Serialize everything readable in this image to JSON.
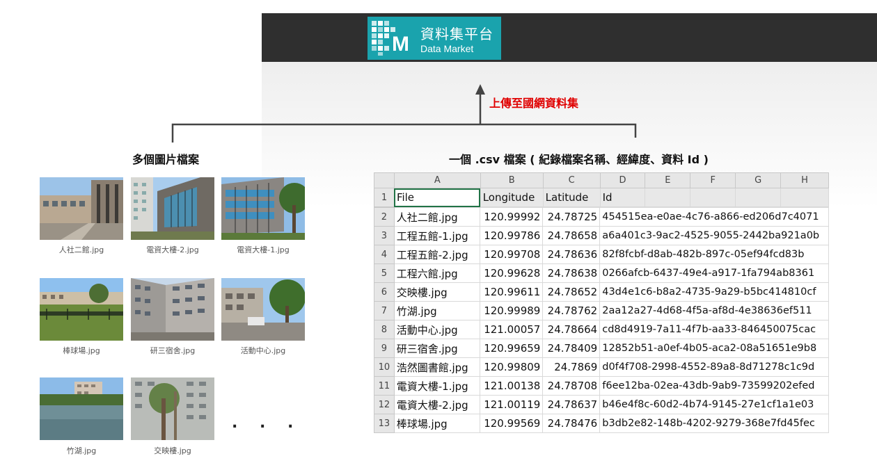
{
  "banner": {
    "logo_cn": "資料集平台",
    "logo_en": "Data Market",
    "colors": {
      "dark": "#2f2f2f",
      "logo_bg": "#1aa3ad"
    }
  },
  "flow": {
    "upload_label": "上傳至國網資料集",
    "upload_color": "#e00000",
    "left_caption": "多個圖片檔案",
    "right_caption": "一個 .csv 檔案 ( 紀錄檔案名稱、經緯度、資料 Id )"
  },
  "thumbnails": [
    {
      "label": "人社二館.jpg",
      "scene": "building-plaza"
    },
    {
      "label": "電資大樓-2.jpg",
      "scene": "building-tall"
    },
    {
      "label": "電資大樓-1.jpg",
      "scene": "building-tree"
    },
    {
      "label": "棒球場.jpg",
      "scene": "field"
    },
    {
      "label": "研三宿舍.jpg",
      "scene": "dorm"
    },
    {
      "label": "活動中心.jpg",
      "scene": "street"
    },
    {
      "label": "竹湖.jpg",
      "scene": "lake"
    },
    {
      "label": "交映樓.jpg",
      "scene": "building-trees"
    }
  ],
  "more": ". . .",
  "spreadsheet": {
    "column_letters": [
      "A",
      "B",
      "C",
      "D",
      "E",
      "F",
      "G",
      "H"
    ],
    "headers": [
      "File",
      "Longitude",
      "Latitude",
      "Id"
    ],
    "rows": [
      [
        "人社二館.jpg",
        "120.99992",
        "24.78725",
        "454515ea-e0ae-4c76-a866-ed206d7c4071"
      ],
      [
        "工程五館-1.jpg",
        "120.99786",
        "24.78658",
        "a6a401c3-9ac2-4525-9055-2442ba921a0b"
      ],
      [
        "工程五館-2.jpg",
        "120.99708",
        "24.78636",
        "82f8fcbf-d8ab-482b-897c-05ef94fcd83b"
      ],
      [
        "工程六館.jpg",
        "120.99628",
        "24.78638",
        "0266afcb-6437-49e4-a917-1fa794ab8361"
      ],
      [
        "交映樓.jpg",
        "120.99611",
        "24.78652",
        "43d4e1c6-b8a2-4735-9a29-b5bc414810cf"
      ],
      [
        "竹湖.jpg",
        "120.99989",
        "24.78762",
        "2aa12a27-4d68-4f5a-af8d-4e38636ef511"
      ],
      [
        "活動中心.jpg",
        "121.00057",
        "24.78664",
        "cd8d4919-7a11-4f7b-aa33-846450075cac"
      ],
      [
        "研三宿舍.jpg",
        "120.99659",
        "24.78409",
        "12852b51-a0ef-4b05-aca2-08a51651e9b8"
      ],
      [
        "浩然圖書館.jpg",
        "120.99809",
        "24.7869",
        "d0f4f708-2998-4552-89a8-8d71278c1c9d"
      ],
      [
        "電資大樓-1.jpg",
        "121.00138",
        "24.78708",
        "f6ee12ba-02ea-43db-9ab9-73599202efed"
      ],
      [
        "電資大樓-2.jpg",
        "121.00119",
        "24.78637",
        "b46e4f8c-60d2-4b74-9145-27e1cf1a1e03"
      ],
      [
        "棒球場.jpg",
        "120.99569",
        "24.78476",
        "b3db2e82-148b-4202-9279-368e7fd45fec"
      ]
    ]
  }
}
